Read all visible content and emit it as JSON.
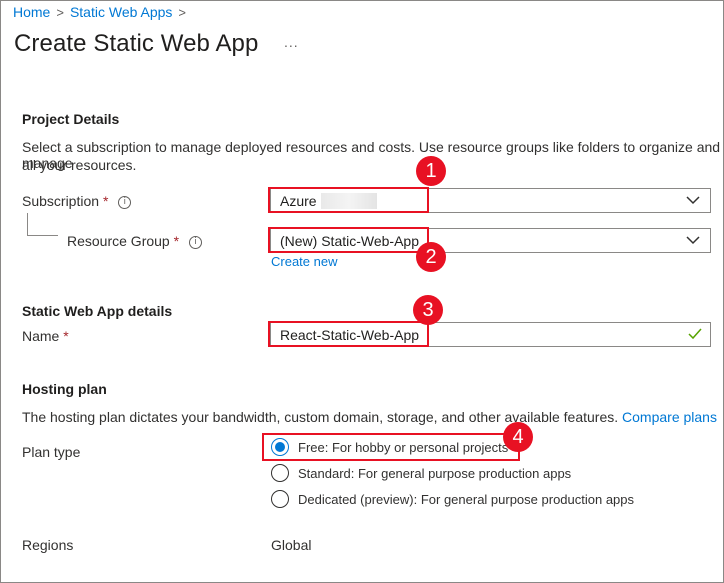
{
  "breadcrumb": {
    "home": "Home",
    "parent": "Static Web Apps",
    "sep": ">"
  },
  "page": {
    "title": "Create Static Web App",
    "more": "..."
  },
  "project": {
    "heading": "Project Details",
    "description_line1": "Select a subscription to manage deployed resources and costs. Use resource groups like folders to organize and manage",
    "description_line2": "all your resources.",
    "subscription_label": "Subscription",
    "subscription_value": "Azure",
    "resource_group_label": "Resource Group",
    "resource_group_value": "(New) Static-Web-App",
    "create_new": "Create new"
  },
  "details": {
    "heading": "Static Web App details",
    "name_label": "Name",
    "name_value": "React-Static-Web-App"
  },
  "hosting": {
    "heading": "Hosting plan",
    "description": "The hosting plan dictates your bandwidth, custom domain, storage, and other available features.",
    "compare_link": "Compare plans",
    "plan_type_label": "Plan type",
    "options": [
      {
        "label": "Free: For hobby or personal projects",
        "selected": true
      },
      {
        "label": "Standard: For general purpose production apps",
        "selected": false
      },
      {
        "label": "Dedicated (preview): For general purpose production apps",
        "selected": false
      }
    ],
    "regions_label": "Regions",
    "regions_value": "Global"
  },
  "required_mark": "*",
  "info_glyph": "i",
  "annotations": [
    "1",
    "2",
    "3",
    "4"
  ],
  "colors": {
    "accent": "#0078d4",
    "callout": "#e81123",
    "required": "#a4262c",
    "valid": "#57a300"
  },
  "icons": {
    "chevron": "chevron-down-icon",
    "check": "checkmark-icon",
    "info": "info-icon",
    "ellipsis": "more-icon"
  }
}
